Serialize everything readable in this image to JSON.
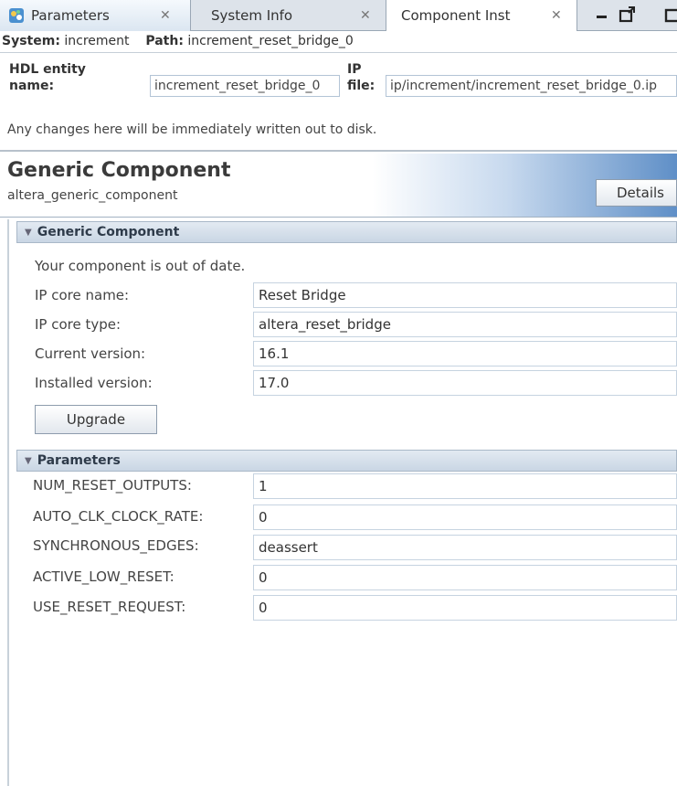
{
  "tabs": {
    "parameters": "Parameters",
    "system_info": "System Info",
    "component_inst": "Component Inst"
  },
  "pathbar": {
    "system_label": "System:",
    "system_value": "increment",
    "path_label": "Path:",
    "path_value": "increment_reset_bridge_0"
  },
  "hdl": {
    "entity_label_1": "HDL entity",
    "entity_label_2": "name:",
    "entity_value": "increment_reset_bridge_0",
    "ip_label_1": "IP",
    "ip_label_2": "file:",
    "ip_value": "ip/increment/increment_reset_bridge_0.ip",
    "note": "Any changes here will be immediately written out to disk."
  },
  "header": {
    "title": "Generic Component",
    "subtitle": "altera_generic_component",
    "details_button": "Details"
  },
  "generic_section": {
    "title": "Generic Component",
    "status": "Your component is out of date.",
    "rows": [
      {
        "label": "IP core name:",
        "value": "Reset Bridge"
      },
      {
        "label": "IP core type:",
        "value": "altera_reset_bridge"
      },
      {
        "label": "Current version:",
        "value": "16.1"
      },
      {
        "label": "Installed version:",
        "value": "17.0"
      }
    ],
    "upgrade_button": "Upgrade"
  },
  "parameters_section": {
    "title": "Parameters",
    "rows": [
      {
        "label": "NUM_RESET_OUTPUTS:",
        "value": "1"
      },
      {
        "label": "AUTO_CLK_CLOCK_RATE:",
        "value": "0"
      },
      {
        "label": "SYNCHRONOUS_EDGES:",
        "value": "deassert"
      },
      {
        "label": "ACTIVE_LOW_RESET:",
        "value": "0"
      },
      {
        "label": "USE_RESET_REQUEST:",
        "value": "0"
      }
    ]
  },
  "icons": {
    "app": "parameters-app-icon",
    "close": "close-icon",
    "minimize": "minimize-icon",
    "maximize": "maximize-icon",
    "restore": "restore-icon",
    "collapse": "triangle-down-icon"
  }
}
